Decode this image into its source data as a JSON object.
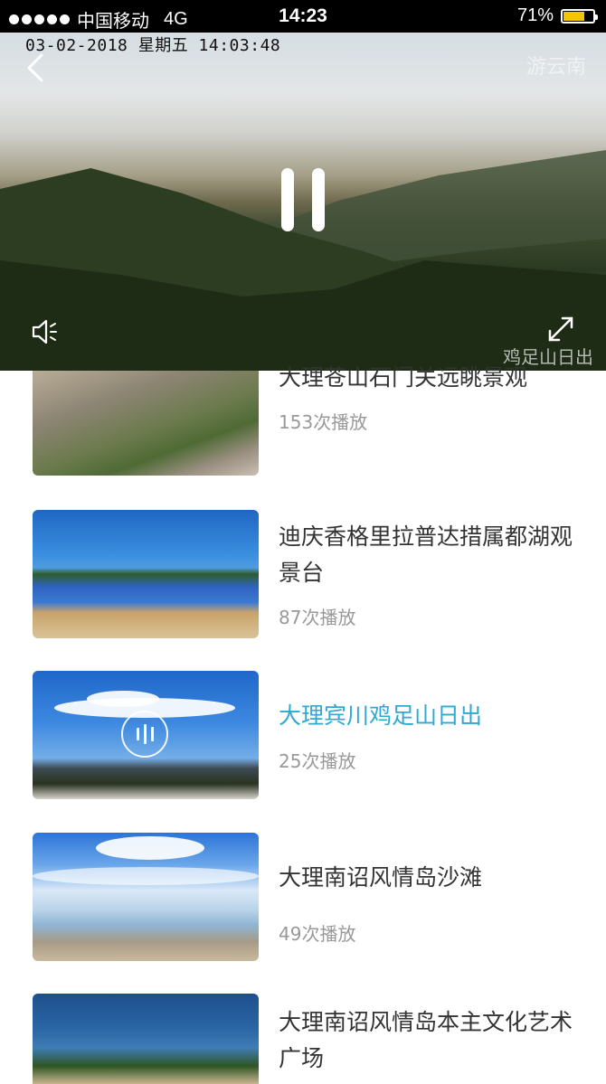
{
  "status_bar": {
    "carrier": "中国移动",
    "network": "4G",
    "time": "14:23",
    "battery_percent": "71%",
    "battery_level": 0.71
  },
  "player": {
    "timestamp": "03-02-2018 星期五 14:03:48",
    "watermark_top": "游云南",
    "watermark_bottom": "鸡足山日出",
    "state": "playing"
  },
  "videos": [
    {
      "title": "大理苍山石门关远眺景观",
      "plays": "153次播放",
      "active": false
    },
    {
      "title": "迪庆香格里拉普达措属都湖观景台",
      "plays": "87次播放",
      "active": false
    },
    {
      "title": "大理宾川鸡足山日出",
      "plays": "25次播放",
      "active": true
    },
    {
      "title": "大理南诏风情岛沙滩",
      "plays": "49次播放",
      "active": false
    },
    {
      "title": "大理南诏风情岛本主文化艺术广场",
      "plays": "",
      "active": false
    }
  ],
  "colors": {
    "accent": "#2ea9d3",
    "title": "#333333",
    "muted": "#999999",
    "battery": "#f5c400"
  }
}
